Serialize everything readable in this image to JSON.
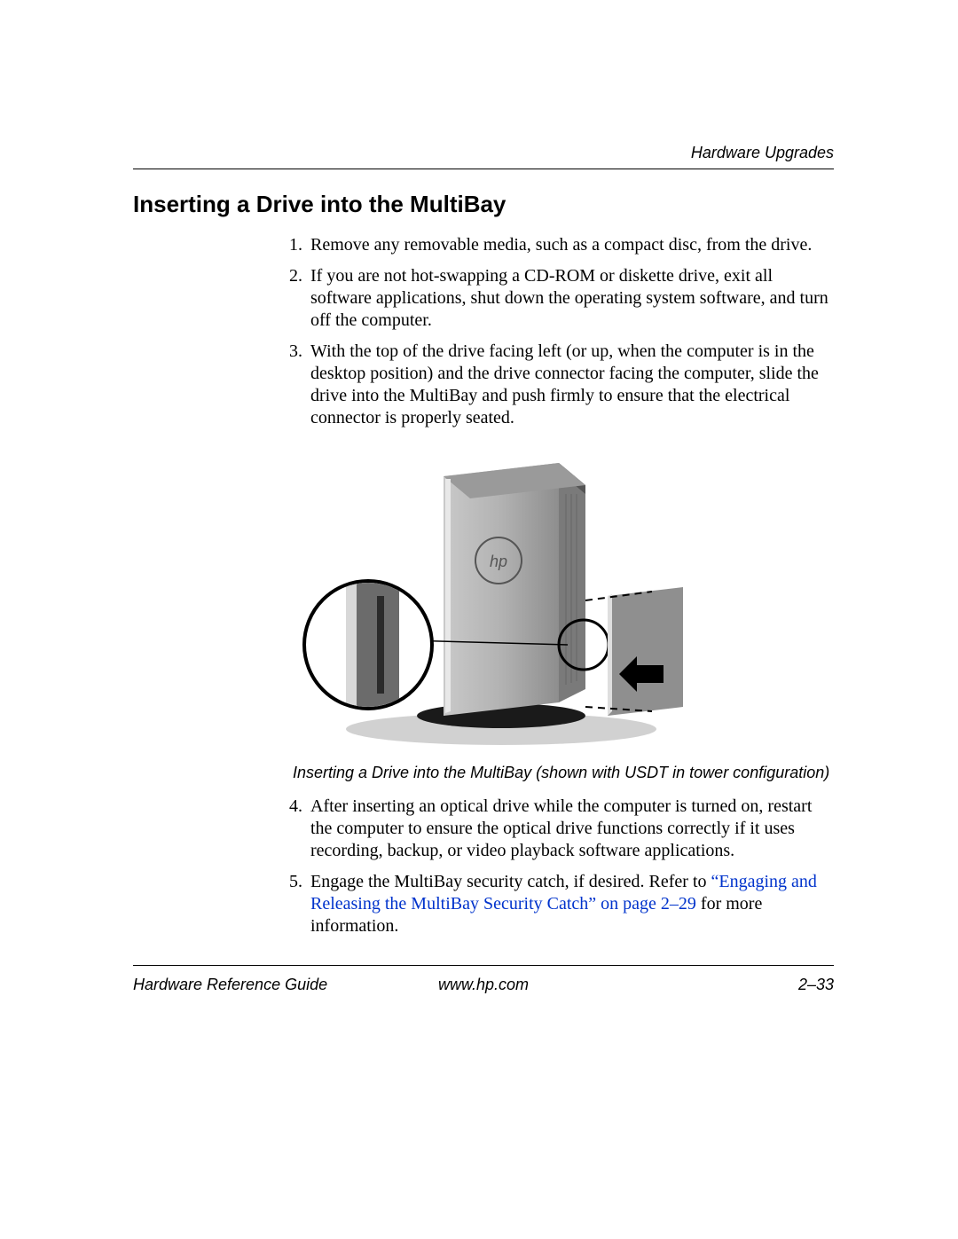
{
  "header": {
    "running_head": "Hardware Upgrades"
  },
  "section": {
    "title": "Inserting a Drive into the MultiBay"
  },
  "steps": {
    "s1": "Remove any removable media, such as a compact disc, from the drive.",
    "s2": "If you are not hot-swapping a CD-ROM or diskette drive, exit all software applications, shut down the operating system software, and turn off the computer.",
    "s3": "With the top of the drive facing left (or up, when the computer is in the desktop position) and the drive connector facing the computer, slide the drive into the MultiBay and push firmly to ensure that the electrical connector is properly seated.",
    "s4": "After inserting an optical drive while the computer is turned on, restart the computer to ensure the optical drive functions correctly if it uses recording, backup, or video playback software applications.",
    "s5_pre": "Engage the MultiBay security catch, if desired. Refer to ",
    "s5_link": "“Engaging and Releasing the MultiBay Security Catch” on page 2–29",
    "s5_post": " for more information."
  },
  "figure": {
    "caption": "Inserting a Drive into the MultiBay (shown with USDT in tower configuration)",
    "hp_logo": "hp"
  },
  "footer": {
    "left": "Hardware Reference Guide",
    "center": "www.hp.com",
    "right": "2–33"
  }
}
